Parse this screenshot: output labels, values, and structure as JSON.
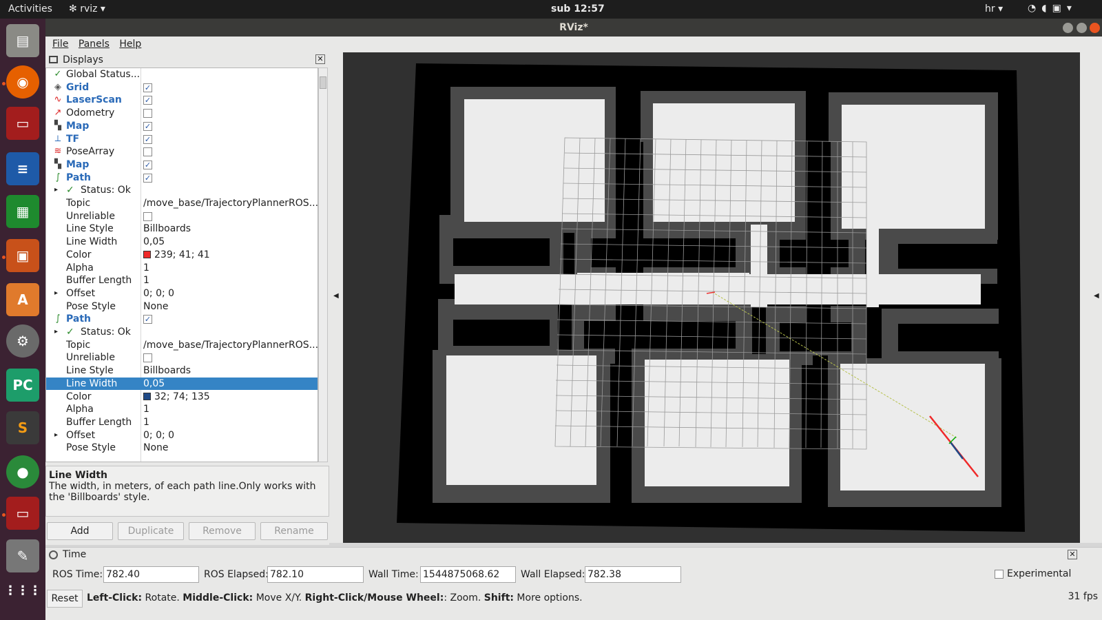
{
  "topbar": {
    "activities": "Activities",
    "app": "rviz",
    "clock": "sub 12:57",
    "lang": "hr"
  },
  "window": {
    "title": "RViz*"
  },
  "menu": {
    "file": "File",
    "panels": "Panels",
    "help": "Help"
  },
  "displays_panel": {
    "title": "Displays",
    "rows": [
      {
        "name": "Global Status...",
        "icon": "check-icon"
      },
      {
        "name": "Grid",
        "checked": true,
        "icon": "grid-icon"
      },
      {
        "name": "LaserScan",
        "checked": true,
        "icon": "laserscan-icon"
      },
      {
        "name": "Odometry",
        "checked": false,
        "icon": "odometry-icon"
      },
      {
        "name": "Map",
        "checked": true,
        "icon": "map-icon"
      },
      {
        "name": "TF",
        "checked": true,
        "icon": "tf-icon"
      },
      {
        "name": "PoseArray",
        "checked": false,
        "icon": "posearray-icon"
      },
      {
        "name": "Map",
        "checked": true,
        "icon": "map-icon"
      },
      {
        "name": "Path",
        "checked": true,
        "icon": "path-icon"
      },
      {
        "name": "Status: Ok"
      },
      {
        "name": "Topic",
        "value": "/move_base/TrajectoryPlannerROS..."
      },
      {
        "name": "Unreliable",
        "checked": false
      },
      {
        "name": "Line Style",
        "value": "Billboards"
      },
      {
        "name": "Line Width",
        "value": "0,05"
      },
      {
        "name": "Color",
        "value": "239; 41; 41",
        "swatch": "#ef2929"
      },
      {
        "name": "Alpha",
        "value": "1"
      },
      {
        "name": "Buffer Length",
        "value": "1"
      },
      {
        "name": "Offset",
        "value": "0; 0; 0"
      },
      {
        "name": "Pose Style",
        "value": "None"
      },
      {
        "name": "Path",
        "checked": true,
        "icon": "path-icon"
      },
      {
        "name": "Status: Ok"
      },
      {
        "name": "Topic",
        "value": "/move_base/TrajectoryPlannerROS..."
      },
      {
        "name": "Unreliable",
        "checked": false
      },
      {
        "name": "Line Style",
        "value": "Billboards"
      },
      {
        "name": "Line Width",
        "value": "0,05",
        "selected": true
      },
      {
        "name": "Color",
        "value": "32; 74; 135",
        "swatch": "#204a87"
      },
      {
        "name": "Alpha",
        "value": "1"
      },
      {
        "name": "Buffer Length",
        "value": "1"
      },
      {
        "name": "Offset",
        "value": "0; 0; 0"
      },
      {
        "name": "Pose Style",
        "value": "None"
      }
    ],
    "description": {
      "title": "Line Width",
      "text": "The width, in meters, of each path line.Only works with the 'Billboards' style."
    },
    "buttons": {
      "add": "Add",
      "duplicate": "Duplicate",
      "remove": "Remove",
      "rename": "Rename"
    }
  },
  "time_panel": {
    "title": "Time",
    "ros_time_label": "ROS Time:",
    "ros_time": "782.40",
    "ros_elapsed_label": "ROS Elapsed:",
    "ros_elapsed": "782.10",
    "wall_time_label": "Wall Time:",
    "wall_time": "1544875068.62",
    "wall_elapsed_label": "Wall Elapsed:",
    "wall_elapsed": "782.38",
    "experimental": "Experimental"
  },
  "statusbar": {
    "reset": "Reset",
    "hint_1b": "Left-Click:",
    "hint_1": " Rotate. ",
    "hint_2b": "Middle-Click:",
    "hint_2": " Move X/Y. ",
    "hint_3b": "Right-Click/Mouse Wheel:",
    "hint_3": ": Zoom. ",
    "hint_4b": "Shift:",
    "hint_4": " More options.",
    "fps": "31 fps"
  },
  "colors": {
    "path1": "#ef2929",
    "path2": "#204a87",
    "selection": "#3584c5",
    "tree_blue": "#2a6ab8"
  }
}
